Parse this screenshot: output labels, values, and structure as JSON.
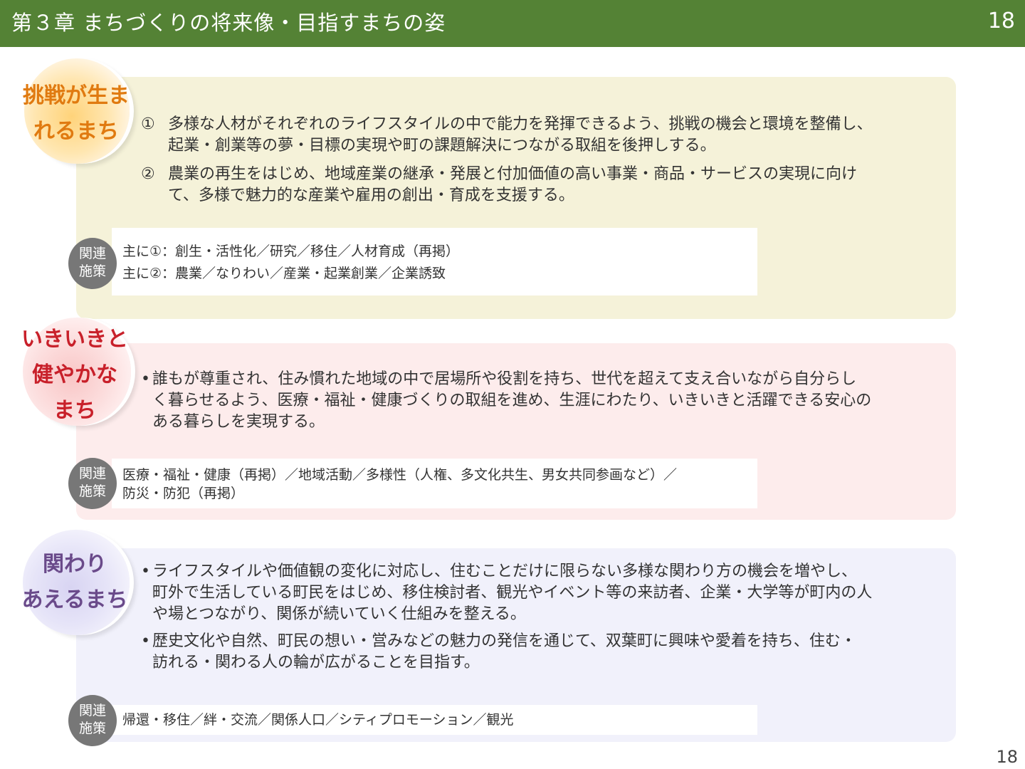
{
  "header": {
    "title": "第３章 まちづくりの将来像・目指すまちの姿",
    "page_number": "18"
  },
  "footer": {
    "page_number": "18"
  },
  "colors": {
    "header_bg": "#548235",
    "panel1_bg": "#f5f2d9",
    "panel2_bg": "#fdecec",
    "panel3_bg": "#f1f1fb",
    "theme1_color": "#e07a10",
    "theme2_color": "#c8202a",
    "theme3_color": "#6a4a8a"
  },
  "sections": [
    {
      "theme_lines": [
        "挑戦が生ま",
        "れるまち"
      ],
      "items": [
        {
          "marker": "①",
          "lines": [
            "多様な人材がそれぞれのライフスタイルの中で能力を発揮できるよう、挑戦の機会と環境を整備し、",
            "起業・創業等の夢・目標の実現や町の課題解決につながる取組を後押しする。"
          ]
        },
        {
          "marker": "②",
          "lines": [
            "農業の再生をはじめ、地域産業の継承・発展と付加価値の高い事業・商品・サービスの実現に向け",
            "て、多様で魅力的な産業や雇用の創出・育成を支援する。"
          ]
        }
      ],
      "related_label": [
        "関連",
        "施策"
      ],
      "related_lines": [
        "主に①：創生・活性化／研究／移住／人材育成（再掲）",
        "主に②：農業／なりわい／産業・起業創業／企業誘致"
      ]
    },
    {
      "theme_lines": [
        "いきいきと",
        "健やかな",
        "まち"
      ],
      "items": [
        {
          "marker": "•",
          "lines": [
            "誰もが尊重され、住み慣れた地域の中で居場所や役割を持ち、世代を超えて支え合いながら自分らし",
            "く暮らせるよう、医療・福祉・健康づくりの取組を進め、生涯にわたり、いきいきと活躍できる安心の",
            "ある暮らしを実現する。"
          ]
        }
      ],
      "related_label": [
        "関連",
        "施策"
      ],
      "related_lines": [
        "医療・福祉・健康（再掲）／地域活動／多様性（人権、多文化共生、男女共同参画など）／",
        "防災・防犯（再掲）"
      ]
    },
    {
      "theme_lines": [
        "関わり",
        "あえるまち"
      ],
      "items": [
        {
          "marker": "•",
          "lines": [
            "ライフスタイルや価値観の変化に対応し、住むことだけに限らない多様な関わり方の機会を増やし、",
            "町外で生活している町民をはじめ、移住検討者、観光やイベント等の来訪者、企業・大学等が町内の人",
            "や場とつながり、関係が続いていく仕組みを整える。"
          ]
        },
        {
          "marker": "•",
          "lines": [
            "歴史文化や自然、町民の想い・営みなどの魅力の発信を通じて、双葉町に興味や愛着を持ち、住む・",
            "訪れる・関わる人の輪が広がることを目指す。"
          ]
        }
      ],
      "related_label": [
        "関連",
        "施策"
      ],
      "related_lines": [
        "帰還・移住／絆・交流／関係人口／シティプロモーション／観光"
      ]
    }
  ]
}
